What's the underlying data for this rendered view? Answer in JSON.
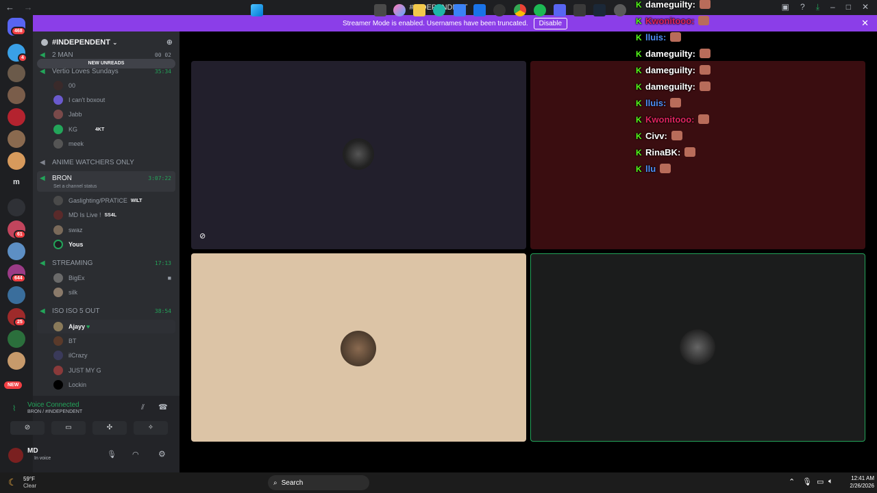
{
  "titlebar": {
    "title": "#INDEPENDENT"
  },
  "banner": {
    "text": "Streamer Mode is enabled. Usernames have been truncated.",
    "disable": "Disable"
  },
  "servers": {
    "badge_top": "468",
    "badge_2": "4",
    "badge_3": "61",
    "badge_4": "644",
    "badge_5": "25",
    "new": "NEW",
    "m": "m"
  },
  "channel_header": {
    "name": "#INDEPENDENT"
  },
  "newunreads": "NEW UNREADS",
  "cut_top": {
    "name": "2 MAN",
    "times": "00  02"
  },
  "vc1": {
    "name": "Vertio Loves Sundays",
    "timer": "35:34",
    "members": [
      "00",
      "I can't boxout",
      "Jabb",
      "KG",
      "meek"
    ],
    "kg_tag": "4KT"
  },
  "vc2": {
    "name": "ANIME WATCHERS ONLY"
  },
  "vc3": {
    "name": "BRON",
    "timer": "3:07:22",
    "status": "Set a channel status",
    "members": [
      "Gaslighting/PRATICE",
      "MD Is Live !",
      "swaz",
      "Yous"
    ],
    "tag1": "WILT",
    "tag2": "SS4L"
  },
  "vc4": {
    "name": "STREAMING",
    "timer": "17:13",
    "members": [
      "BigEx",
      "silk"
    ]
  },
  "vc5": {
    "name": "ISO ISO 5 OUT",
    "timer": "38:54",
    "members": [
      "Ajayy",
      "BT",
      "ilCrazy",
      "JUST MY G",
      "Lockin"
    ]
  },
  "voice": {
    "status": "Voice Connected",
    "channel": "BRON / #INDEPENDENT"
  },
  "user": {
    "name": "MD",
    "status": "In voice"
  },
  "chat": [
    {
      "name": "dameguilty:",
      "color": "#ffffff"
    },
    {
      "name": "Kwonitooo:",
      "color": "#e0245e"
    },
    {
      "name": "lluis:",
      "color": "#4f8ff7"
    },
    {
      "name": "dameguilty:",
      "color": "#ffffff"
    },
    {
      "name": "dameguilty:",
      "color": "#ffffff"
    },
    {
      "name": "dameguilty:",
      "color": "#ffffff"
    },
    {
      "name": "lluis:",
      "color": "#4f8ff7"
    },
    {
      "name": "Kwonitooo:",
      "color": "#e0245e"
    },
    {
      "name": "Civv:",
      "color": "#ffffff"
    },
    {
      "name": "RinaBK:",
      "color": "#ffffff"
    },
    {
      "name": "llu",
      "color": "#4f8ff7"
    }
  ],
  "taskbar": {
    "weather_temp": "59°F",
    "weather_desc": "Clear",
    "search": "Search",
    "time": "12:41 AM",
    "date": "2/26/2026"
  }
}
